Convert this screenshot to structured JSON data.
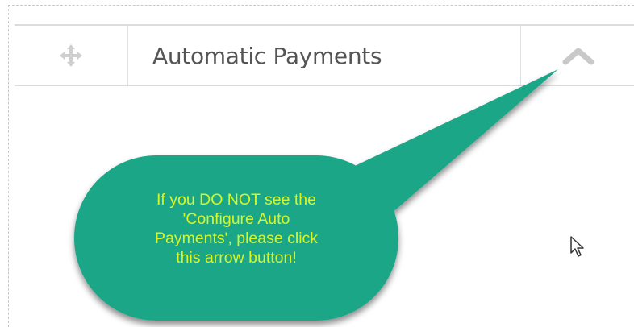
{
  "panel": {
    "title": "Automatic Payments",
    "drag_icon": "move-icon",
    "toggle_icon": "chevron-up-icon"
  },
  "callout": {
    "lines": [
      "If you DO NOT see the",
      "'Configure Auto",
      "Payments', please click",
      "this arrow button!"
    ],
    "fill_color": "#1fa688",
    "text_color": "#d6f52a"
  },
  "cursor": {
    "icon": "mouse-pointer-icon"
  }
}
